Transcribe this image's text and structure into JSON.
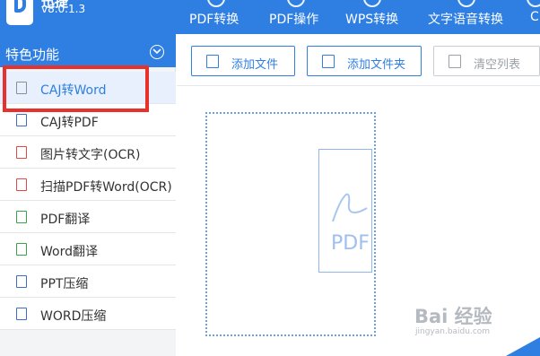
{
  "header": {
    "app_name": "迅捷",
    "version": "v8.0.1.3",
    "nav": [
      {
        "label": "PDF转换",
        "icon": "pdf-convert-icon"
      },
      {
        "label": "PDF操作",
        "icon": "pdf-operate-icon"
      },
      {
        "label": "WPS转换",
        "icon": "wps-convert-icon"
      },
      {
        "label": "文字语音转换",
        "icon": "text-voice-icon"
      },
      {
        "label": "C",
        "icon": "more-icon"
      }
    ],
    "colors": {
      "brand": "#2f7fe3"
    }
  },
  "sidebar": {
    "title": "特色功能",
    "items": [
      {
        "label": "CAJ转Word",
        "icon": "caj-file-icon",
        "active": true
      },
      {
        "label": "CAJ转PDF",
        "icon": "pdf-file-icon"
      },
      {
        "label": "图片转文字(OCR)",
        "icon": "ocr-image-icon"
      },
      {
        "label": "扫描PDF转Word(OCR)",
        "icon": "scan-ocr-icon"
      },
      {
        "label": "PDF翻译",
        "icon": "pdf-translate-icon"
      },
      {
        "label": "Word翻译",
        "icon": "word-translate-icon"
      },
      {
        "label": "PPT压缩",
        "icon": "ppt-compress-icon"
      },
      {
        "label": "WORD压缩",
        "icon": "word-compress-icon"
      }
    ]
  },
  "toolbar": {
    "add_file": "添加文件",
    "add_folder": "添加文件夹",
    "clear_list": "清空列表"
  },
  "dropzone": {
    "card_text": "PDF"
  },
  "watermark": {
    "main": "Bai 经验",
    "sub": "jingyan.baidu.com"
  }
}
